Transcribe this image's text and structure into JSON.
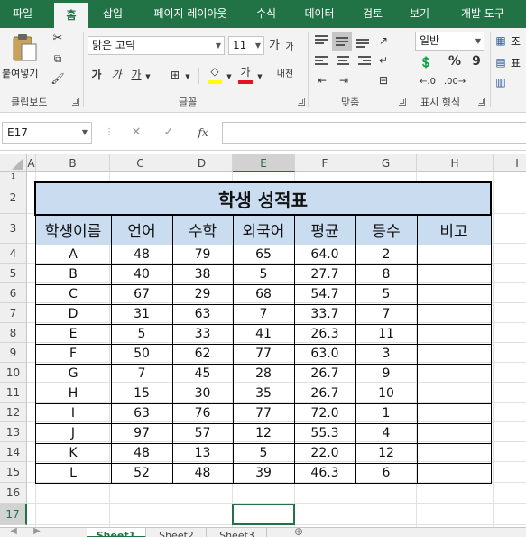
{
  "ribbon_tabs": [
    "파일",
    "홈",
    "삽입",
    "페이지 레이아웃",
    "수식",
    "데이터",
    "검토",
    "보기",
    "개발 도구"
  ],
  "active_tab": "홈",
  "clipboard": {
    "paste_label": "붙여넣기",
    "group_label": "클립보드"
  },
  "font": {
    "name": "맑은 고딕",
    "size": "11",
    "bold": "가",
    "italic": "가",
    "underline": "가",
    "grow": "가",
    "shrink": "가",
    "color_sample": "가",
    "phonetic": "내천",
    "group_label": "글꼴",
    "font_color": "#e81123",
    "fill_color": "#ffff00"
  },
  "alignment": {
    "group_label": "맞춤"
  },
  "number": {
    "format": "일반",
    "percent": "%",
    "comma": "9",
    "group_label": "표시 형식"
  },
  "extra_group": {
    "label1": "조",
    "label2": "표"
  },
  "formula_bar": {
    "name_box": "E17",
    "cancel": "✕",
    "enter": "✓",
    "fx": "fx",
    "value": ""
  },
  "columns": [
    "A",
    "B",
    "C",
    "D",
    "E",
    "F",
    "G",
    "H",
    "I"
  ],
  "rows": [
    "1",
    "2",
    "3",
    "4",
    "5",
    "6",
    "7",
    "8",
    "9",
    "10",
    "11",
    "12",
    "13",
    "14",
    "15",
    "16",
    "17"
  ],
  "selected_cell": {
    "col": "E",
    "row": "17"
  },
  "report": {
    "title": "학생 성적표",
    "headers": [
      "학생이름",
      "언어",
      "수학",
      "외국어",
      "평균",
      "등수",
      "비고"
    ],
    "rows": [
      [
        "A",
        "48",
        "79",
        "65",
        "64.0",
        "2",
        ""
      ],
      [
        "B",
        "40",
        "38",
        "5",
        "27.7",
        "8",
        ""
      ],
      [
        "C",
        "67",
        "29",
        "68",
        "54.7",
        "5",
        ""
      ],
      [
        "D",
        "31",
        "63",
        "7",
        "33.7",
        "7",
        ""
      ],
      [
        "E",
        "5",
        "33",
        "41",
        "26.3",
        "11",
        ""
      ],
      [
        "F",
        "50",
        "62",
        "77",
        "63.0",
        "3",
        ""
      ],
      [
        "G",
        "7",
        "45",
        "28",
        "26.7",
        "9",
        ""
      ],
      [
        "H",
        "15",
        "30",
        "35",
        "26.7",
        "10",
        ""
      ],
      [
        "I",
        "63",
        "76",
        "77",
        "72.0",
        "1",
        ""
      ],
      [
        "J",
        "97",
        "57",
        "12",
        "55.3",
        "4",
        ""
      ],
      [
        "K",
        "48",
        "13",
        "5",
        "22.0",
        "12",
        ""
      ],
      [
        "L",
        "52",
        "48",
        "39",
        "46.3",
        "6",
        ""
      ]
    ]
  },
  "sheets": [
    "Sheet1",
    "Sheet2",
    "Sheet3"
  ],
  "active_sheet": "Sheet1"
}
